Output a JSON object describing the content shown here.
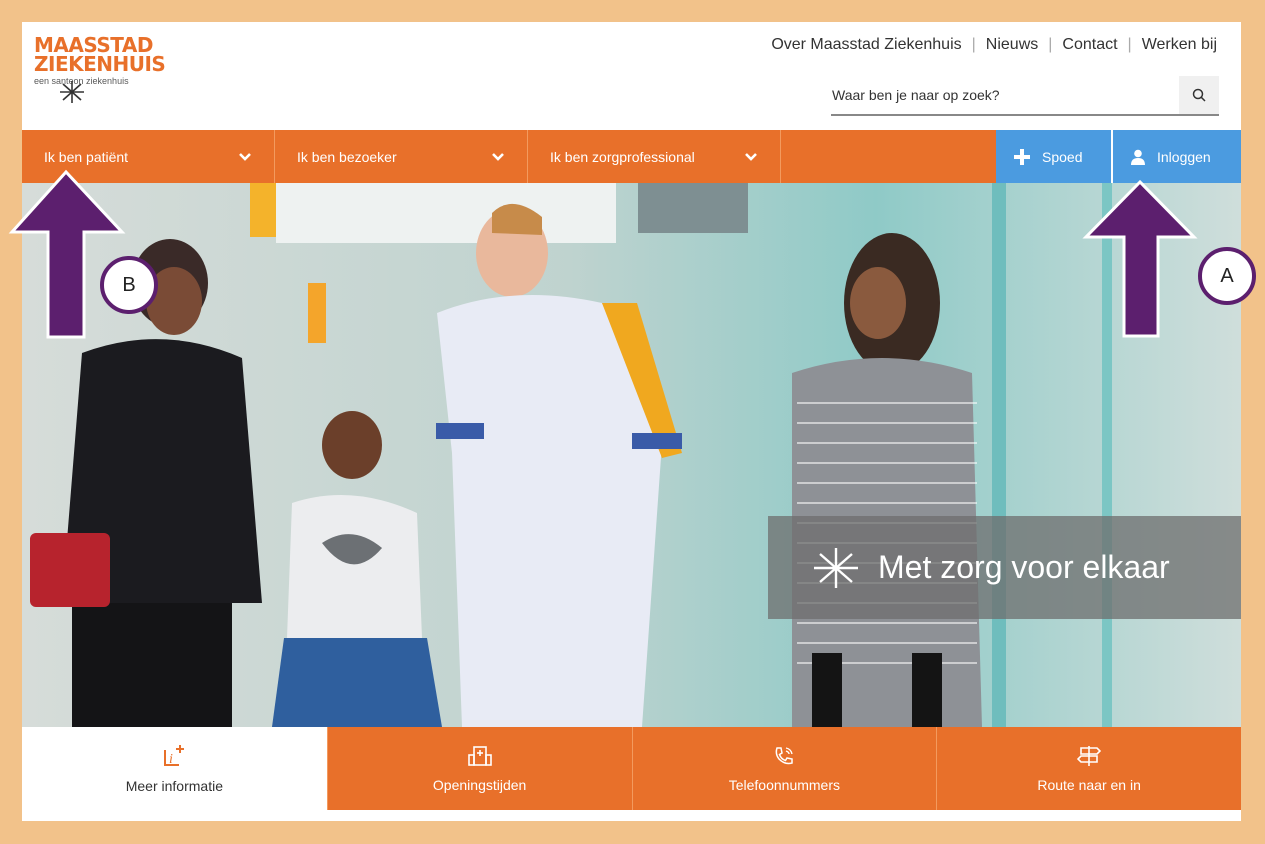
{
  "logo": {
    "line1": "MAASSTAD",
    "line2": "ZIEKENHUIS",
    "sub": "een santeon ziekenhuis"
  },
  "topnav": [
    "Over Maasstad Ziekenhuis",
    "Nieuws",
    "Contact",
    "Werken bij"
  ],
  "search": {
    "placeholder": "Waar ben je naar op zoek?"
  },
  "mainnav": {
    "items": [
      "Ik ben patiënt",
      "Ik ben bezoeker",
      "Ik ben zorgprofessional"
    ],
    "spoed": "Spoed",
    "login": "Inloggen"
  },
  "hero": {
    "tagline": "Met zorg voor elkaar"
  },
  "quicklinks": [
    "Meer informatie",
    "Openingstijden",
    "Telefoonnummers",
    "Route naar en in"
  ],
  "annotations": {
    "a": "A",
    "b": "B"
  },
  "colors": {
    "brand_orange": "#e8702a",
    "accent_blue": "#4b9be0",
    "annotation_purple": "#5c1f6e",
    "border_peach": "#f2c28a"
  }
}
